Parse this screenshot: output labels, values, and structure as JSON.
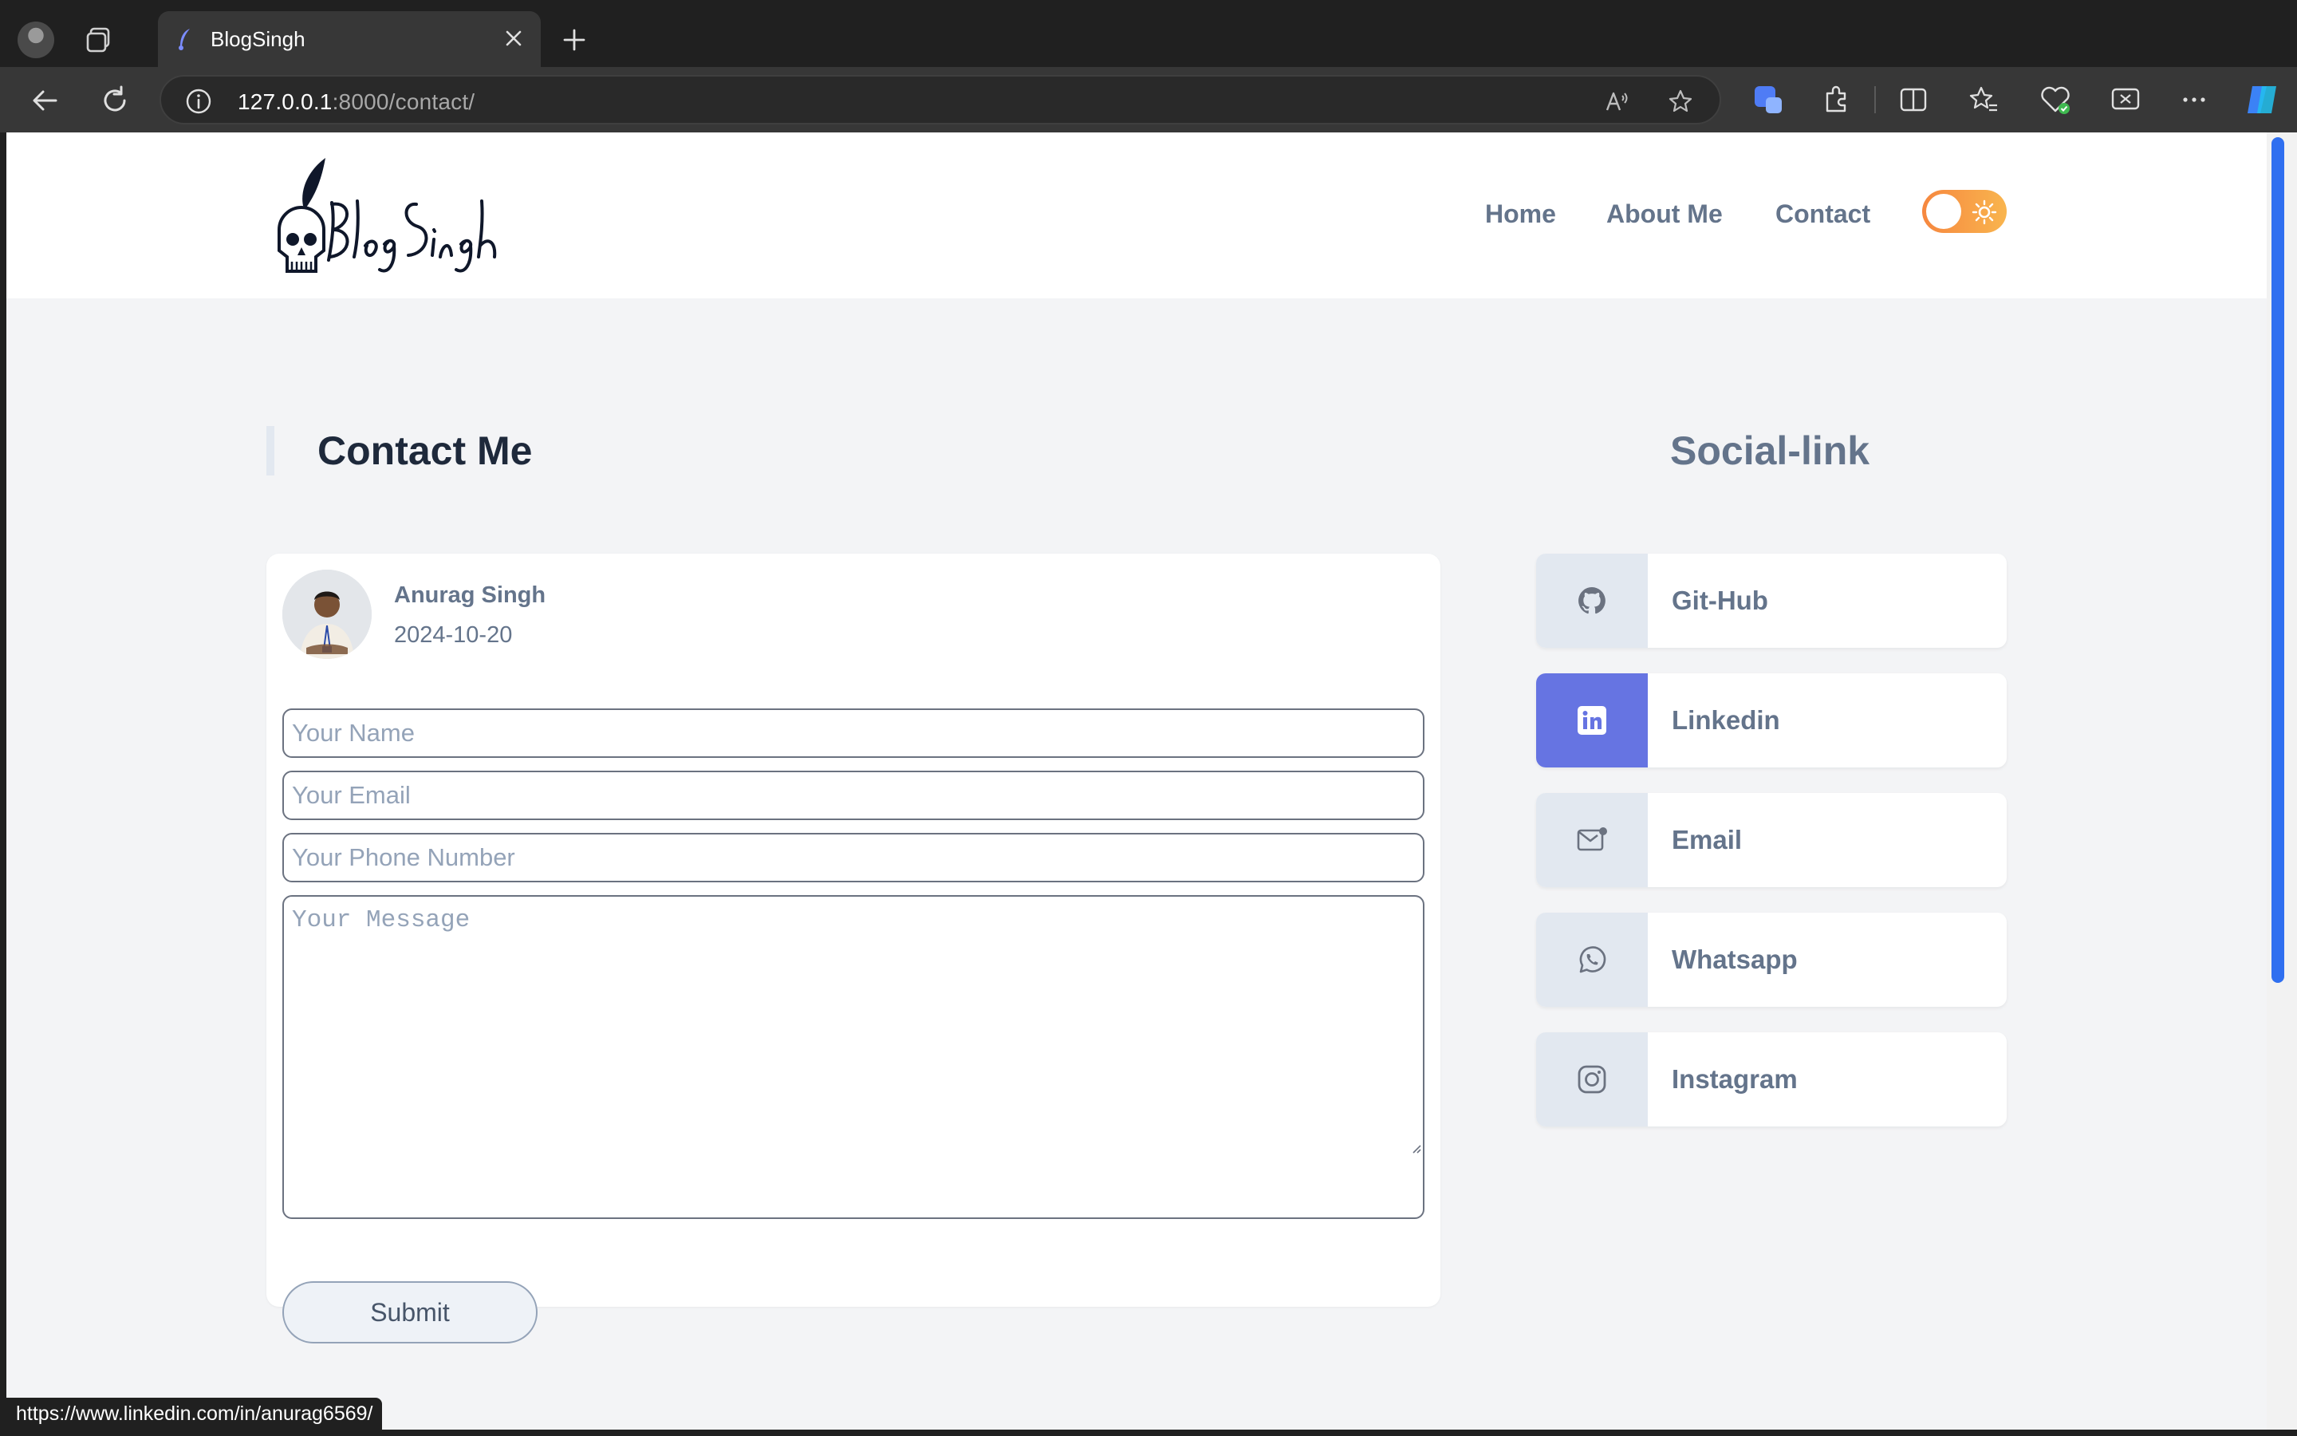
{
  "browser": {
    "tab_title": "BlogSingh",
    "url_host": "127.0.0.1",
    "url_rest": ":8000/contact/"
  },
  "site": {
    "logo_alt": "Blog Singh",
    "nav": {
      "home": "Home",
      "about": "About Me",
      "contact": "Contact"
    },
    "theme_toggle": "light"
  },
  "contact": {
    "heading": "Contact Me",
    "author": "Anurag Singh",
    "date": "2024-10-20",
    "placeholders": {
      "name": "Your Name",
      "email": "Your Email",
      "phone": "Your Phone Number",
      "message": "Your Message"
    },
    "submit_label": "Submit"
  },
  "social": {
    "heading": "Social-link",
    "links": [
      {
        "label": "Git-Hub",
        "icon": "github-icon"
      },
      {
        "label": "Linkedin",
        "icon": "linkedin-icon",
        "active": true
      },
      {
        "label": "Email",
        "icon": "email-icon"
      },
      {
        "label": "Whatsapp",
        "icon": "whatsapp-icon"
      },
      {
        "label": "Instagram",
        "icon": "instagram-icon"
      }
    ]
  },
  "status_bar": {
    "hover_url": "https://www.linkedin.com/in/anurag6569/"
  },
  "colors": {
    "accent": "#6674e2",
    "toggle_start": "#f6873f",
    "toggle_end": "#f9b54e",
    "page_bg": "#f3f4f6"
  }
}
